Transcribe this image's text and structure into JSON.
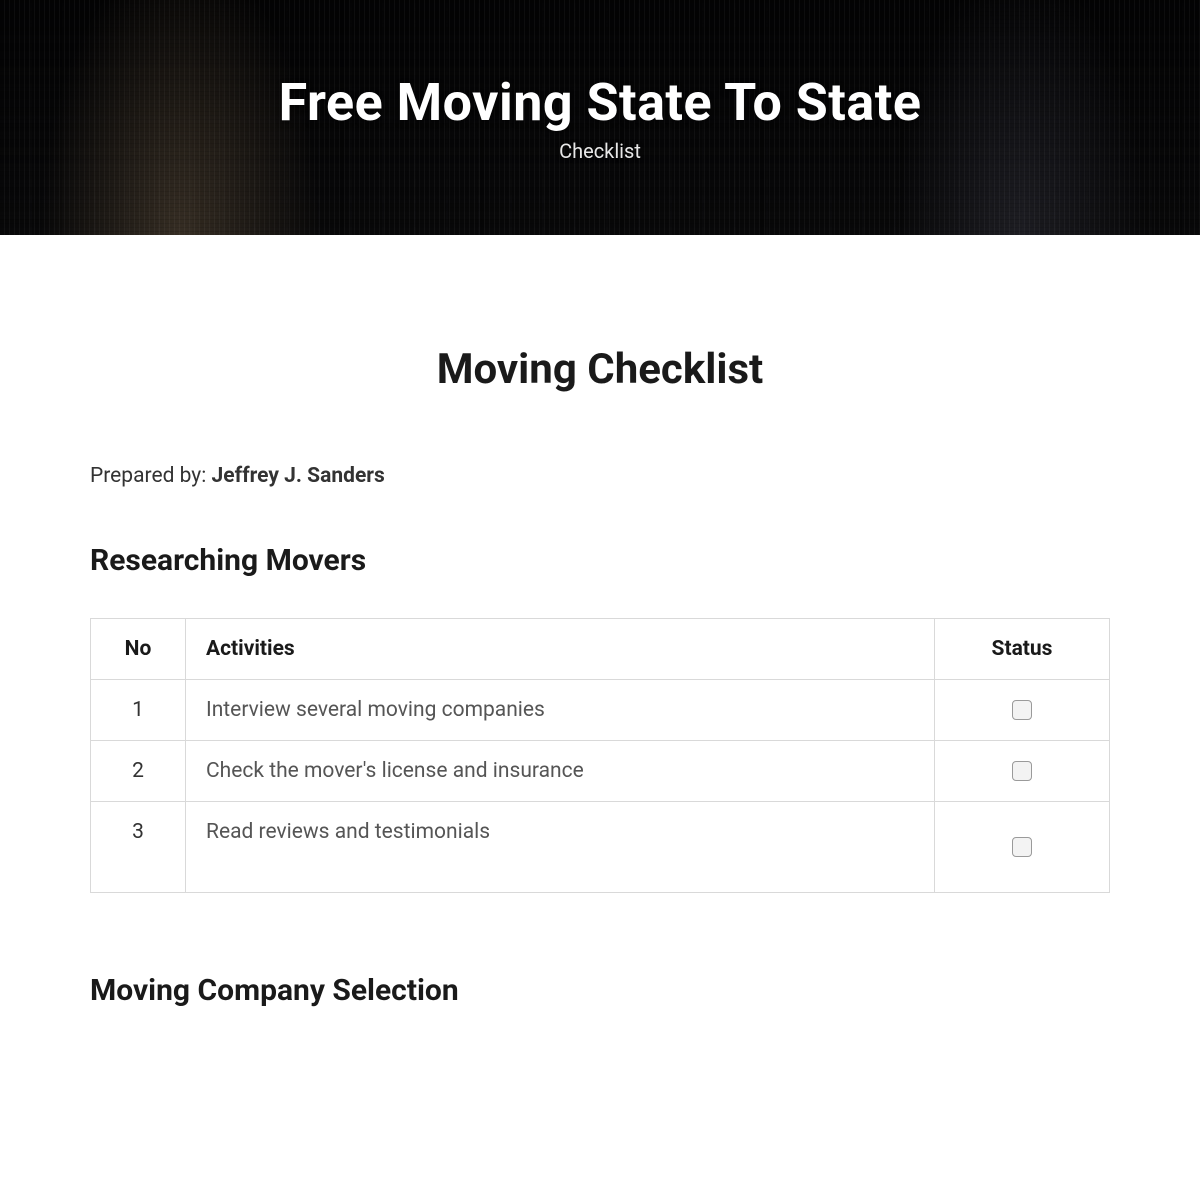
{
  "hero": {
    "title": "Free Moving State To State",
    "subtitle": "Checklist"
  },
  "document": {
    "title": "Moving Checklist",
    "prepared_label": "Prepared by: ",
    "prepared_name": "Jeffrey J. Sanders"
  },
  "sections": [
    {
      "heading": "Researching Movers",
      "columns": {
        "no": "No",
        "activities": "Activities",
        "status": "Status"
      },
      "rows": [
        {
          "no": "1",
          "activity": "Interview several moving companies",
          "checked": false
        },
        {
          "no": "2",
          "activity": "Check the mover's license and insurance",
          "checked": false
        },
        {
          "no": "3",
          "activity": "Read reviews and testimonials",
          "checked": false
        }
      ]
    },
    {
      "heading": "Moving Company Selection"
    }
  ]
}
